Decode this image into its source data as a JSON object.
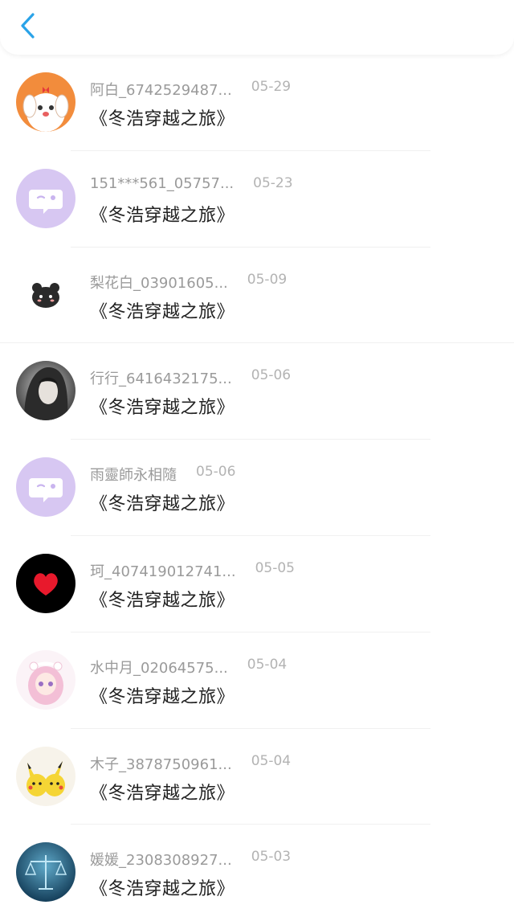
{
  "header": {
    "back_icon": "chevron-left-icon",
    "accent": "#2aa3e8"
  },
  "items": [
    {
      "name": "阿白_6742529487...",
      "date": "05-29",
      "title": "《冬浩穿越之旅》",
      "avatar": "puppy-avatar"
    },
    {
      "name": "151***561_05757...",
      "date": "05-23",
      "title": "《冬浩穿越之旅》",
      "avatar": "default-chat-avatar"
    },
    {
      "name": "梨花白_03901605...",
      "date": "05-09",
      "title": "《冬浩穿越之旅》",
      "avatar": "black-bear-avatar"
    },
    {
      "name": "行行_6416432175...",
      "date": "05-06",
      "title": "《冬浩穿越之旅》",
      "avatar": "portrait-avatar"
    },
    {
      "name": "雨靈師永相隨",
      "date": "05-06",
      "title": "《冬浩穿越之旅》",
      "avatar": "default-chat-avatar"
    },
    {
      "name": "珂_407419012741...",
      "date": "05-05",
      "title": "《冬浩穿越之旅》",
      "avatar": "red-heart-avatar"
    },
    {
      "name": "水中月_02064575...",
      "date": "05-04",
      "title": "《冬浩穿越之旅》",
      "avatar": "anime-girl-avatar"
    },
    {
      "name": "木子_3878750961...",
      "date": "05-04",
      "title": "《冬浩穿越之旅》",
      "avatar": "pikachu-avatar"
    },
    {
      "name": "媛媛_2308308927...",
      "date": "05-03",
      "title": "《冬浩穿越之旅》",
      "avatar": "libra-avatar"
    }
  ]
}
